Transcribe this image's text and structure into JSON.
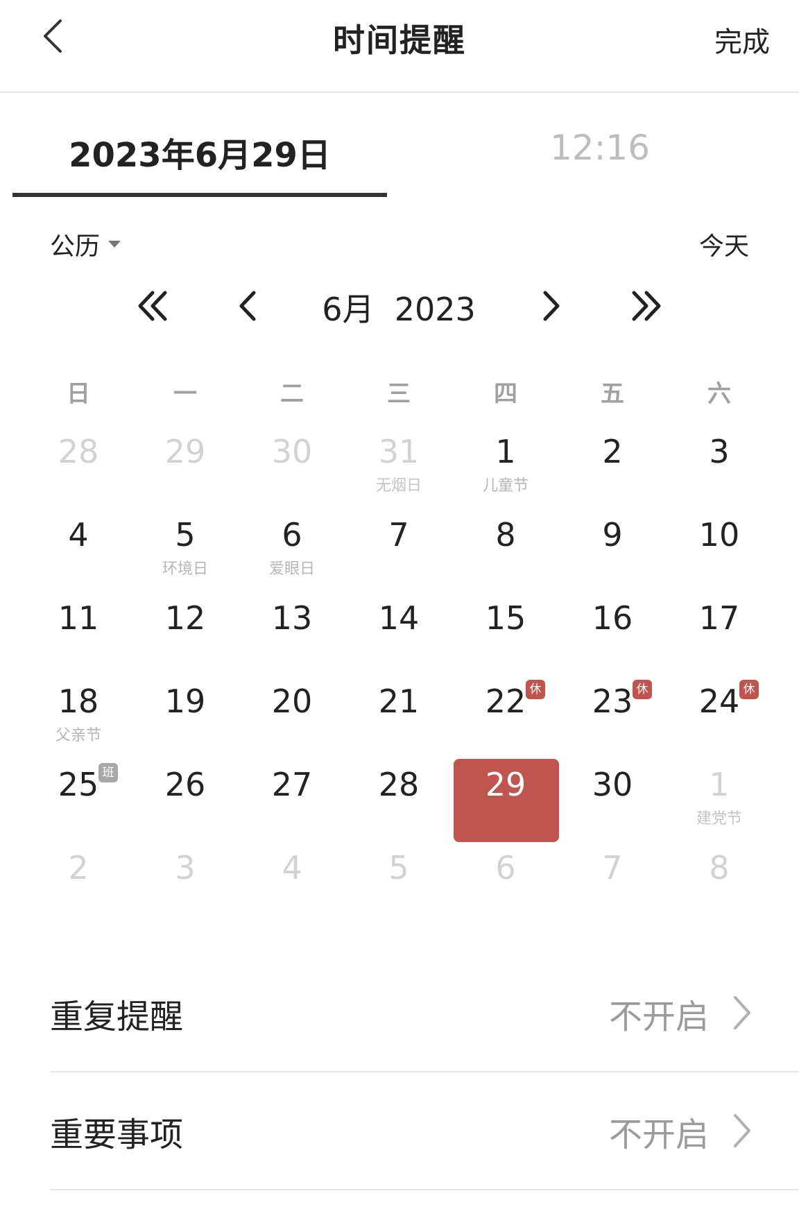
{
  "header": {
    "title": "时间提醒",
    "done_label": "完成"
  },
  "tabs": {
    "date_label": "2023年6月29日",
    "time_label": "12:16"
  },
  "calendar": {
    "type_label": "公历",
    "today_label": "今天",
    "month_label": "6月",
    "year_label": "2023",
    "weekdays": [
      "日",
      "一",
      "二",
      "三",
      "四",
      "五",
      "六"
    ],
    "days": [
      {
        "num": "28",
        "sub": "",
        "muted": true
      },
      {
        "num": "29",
        "sub": "",
        "muted": true
      },
      {
        "num": "30",
        "sub": "",
        "muted": true
      },
      {
        "num": "31",
        "sub": "无烟日",
        "muted": true
      },
      {
        "num": "1",
        "sub": "儿童节"
      },
      {
        "num": "2",
        "sub": ""
      },
      {
        "num": "3",
        "sub": ""
      },
      {
        "num": "4",
        "sub": ""
      },
      {
        "num": "5",
        "sub": "环境日"
      },
      {
        "num": "6",
        "sub": "爱眼日"
      },
      {
        "num": "7",
        "sub": ""
      },
      {
        "num": "8",
        "sub": ""
      },
      {
        "num": "9",
        "sub": ""
      },
      {
        "num": "10",
        "sub": ""
      },
      {
        "num": "11",
        "sub": ""
      },
      {
        "num": "12",
        "sub": ""
      },
      {
        "num": "13",
        "sub": ""
      },
      {
        "num": "14",
        "sub": ""
      },
      {
        "num": "15",
        "sub": ""
      },
      {
        "num": "16",
        "sub": ""
      },
      {
        "num": "17",
        "sub": ""
      },
      {
        "num": "18",
        "sub": "父亲节"
      },
      {
        "num": "19",
        "sub": ""
      },
      {
        "num": "20",
        "sub": ""
      },
      {
        "num": "21",
        "sub": ""
      },
      {
        "num": "22",
        "sub": "",
        "badge": "休",
        "badge_type": "rest"
      },
      {
        "num": "23",
        "sub": "",
        "badge": "休",
        "badge_type": "rest"
      },
      {
        "num": "24",
        "sub": "",
        "badge": "休",
        "badge_type": "rest"
      },
      {
        "num": "25",
        "sub": "",
        "badge": "班",
        "badge_type": "work"
      },
      {
        "num": "26",
        "sub": ""
      },
      {
        "num": "27",
        "sub": ""
      },
      {
        "num": "28",
        "sub": ""
      },
      {
        "num": "29",
        "sub": "",
        "selected": true
      },
      {
        "num": "30",
        "sub": ""
      },
      {
        "num": "1",
        "sub": "建党节",
        "muted": true
      },
      {
        "num": "2",
        "sub": "",
        "muted": true
      },
      {
        "num": "3",
        "sub": "",
        "muted": true
      },
      {
        "num": "4",
        "sub": "",
        "muted": true
      },
      {
        "num": "5",
        "sub": "",
        "muted": true
      },
      {
        "num": "6",
        "sub": "",
        "muted": true
      },
      {
        "num": "7",
        "sub": "",
        "muted": true
      },
      {
        "num": "8",
        "sub": "",
        "muted": true
      }
    ]
  },
  "settings": {
    "repeat_label": "重复提醒",
    "repeat_value": "不开启",
    "important_label": "重要事项",
    "important_value": "不开启"
  },
  "colors": {
    "accent": "#c0544f",
    "work_badge": "#a8a8a8"
  },
  "icons": {
    "back": "chevron-left-icon",
    "dropdown": "caret-down-icon",
    "prev_year": "double-chevron-left-icon",
    "prev_month": "chevron-left-icon",
    "next_month": "chevron-right-icon",
    "next_year": "double-chevron-right-icon",
    "row_arrow": "chevron-right-icon"
  }
}
